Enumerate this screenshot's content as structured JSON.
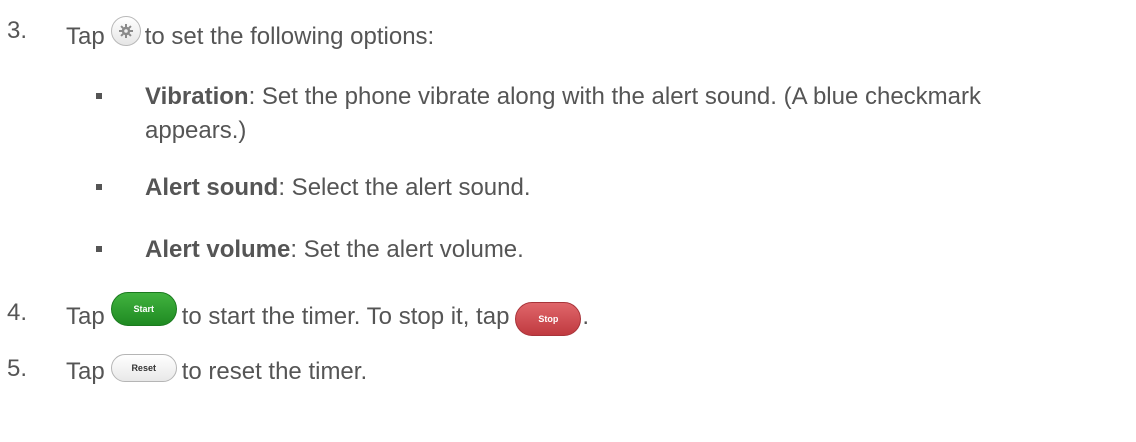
{
  "steps": [
    {
      "number": "3.",
      "before": "Tap",
      "icon": "gear-icon",
      "after": "to set the following options:"
    },
    {
      "number": "4.",
      "before": "Tap",
      "button1": "Start",
      "middle": "to start the timer. To stop it, tap",
      "button2": "Stop",
      "after": "."
    },
    {
      "number": "5.",
      "before": "Tap",
      "button": "Reset",
      "after": "to reset the timer."
    }
  ],
  "options": [
    {
      "term": "Vibration",
      "desc_line1": ": Set the phone vibrate along with the alert sound. (A blue checkmark",
      "desc_line2": "appears.)"
    },
    {
      "term": "Alert sound",
      "desc": ": Select the alert sound."
    },
    {
      "term": "Alert volume",
      "desc": ": Set the alert volume."
    }
  ],
  "colors": {
    "text": "#555555",
    "start_button": "#2a9a2c",
    "stop_button": "#d04e53",
    "reset_button": "#f2f2f2"
  }
}
